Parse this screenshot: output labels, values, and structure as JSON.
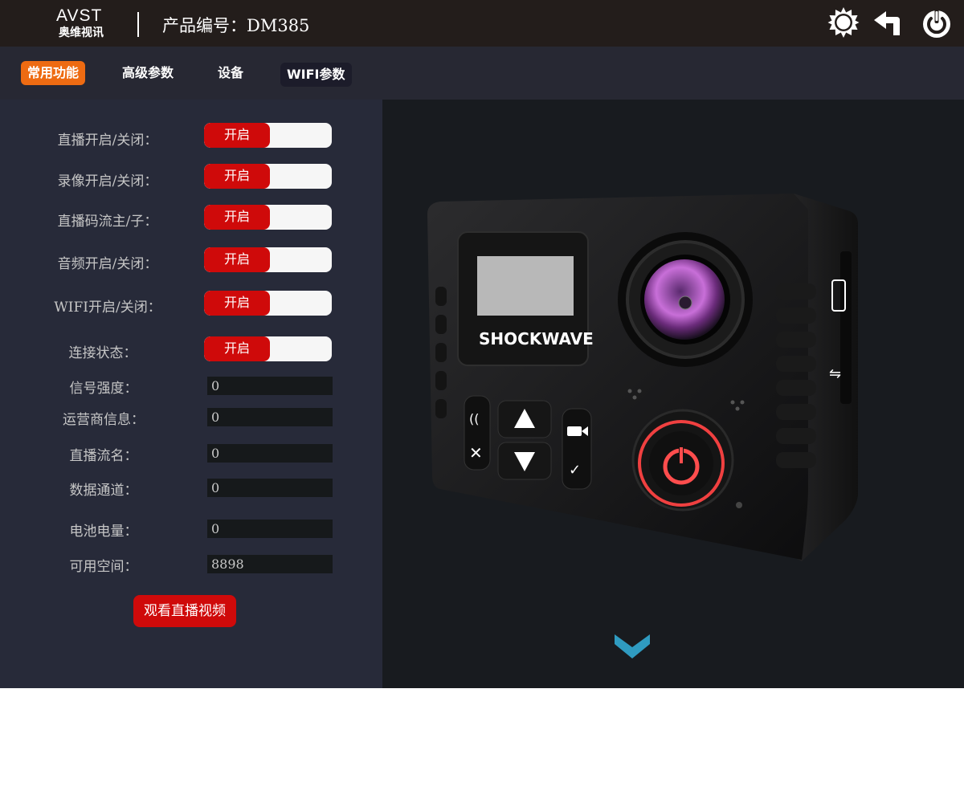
{
  "header": {
    "logo_en": "AVST",
    "logo_cn": "奥维视讯",
    "product_number": "产品编号：DM385"
  },
  "tabs": [
    {
      "label": "常用功能",
      "active": true
    },
    {
      "label": "高级参数",
      "active": false
    },
    {
      "label": "设备",
      "active": false
    },
    {
      "label": "WIFI参数",
      "active": false
    }
  ],
  "settings": {
    "live": {
      "label": "直播开启/关闭：",
      "state": "开启"
    },
    "record": {
      "label": "录像开启/关闭：",
      "state": "开启"
    },
    "stream_type": {
      "label": "直播码流主/子：",
      "state": "开启"
    },
    "audio": {
      "label": "音频开启/关闭：",
      "state": "开启"
    },
    "wifi": {
      "label": "WIFI开启/关闭：",
      "state": "开启"
    },
    "connection": {
      "label": "连接状态：",
      "state": "开启"
    }
  },
  "info": {
    "signal": {
      "label": "信号强度：",
      "value": "0"
    },
    "carrier": {
      "label": "运营商信息：",
      "value": "0"
    },
    "stream_name": {
      "label": "直播流名：",
      "value": "0"
    },
    "data_channel": {
      "label": "数据通道：",
      "value": "0"
    },
    "battery": {
      "label": "电池电量：",
      "value": "0"
    },
    "free_space": {
      "label": "可用空间：",
      "value": "8898"
    }
  },
  "actions": {
    "watch_live": "观看直播视频"
  },
  "camera": {
    "brand": "SHOCKWAVE"
  },
  "icons": {
    "settings": "gear-icon",
    "back": "back-arrow-icon",
    "power": "power-icon",
    "scroll": "chevron-down-icon"
  },
  "colors": {
    "accent": "#ee6b12",
    "toggle_on": "#cf0a0a",
    "header_bg": "#231d1b",
    "panel_bg": "#272a39",
    "chevron": "#2f9bc0"
  }
}
